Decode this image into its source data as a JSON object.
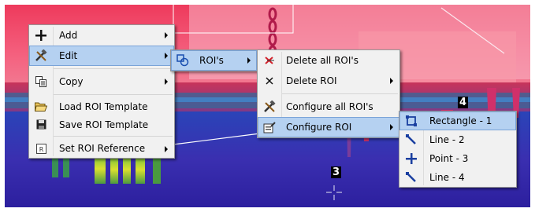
{
  "main_menu": {
    "items": [
      {
        "label": "Add",
        "icon": "plus-icon",
        "submenu": true
      },
      {
        "label": "Edit",
        "icon": "tools-icon",
        "submenu": true,
        "highlighted": true
      },
      {
        "label": "Copy",
        "icon": "copy-icon",
        "submenu": true
      },
      {
        "label": "Load ROI Template",
        "icon": "folder-open-icon"
      },
      {
        "label": "Save ROI Template",
        "icon": "floppy-disk-icon"
      },
      {
        "label": "Set ROI Reference",
        "icon": "reference-icon",
        "submenu": true
      }
    ]
  },
  "edit_menu": {
    "items": [
      {
        "label": "ROI's",
        "icon": "roi-shapes-icon",
        "submenu": true,
        "highlighted": true
      }
    ]
  },
  "rois_menu": {
    "items": [
      {
        "label": "Delete all ROI's",
        "icon": "delete-all-icon"
      },
      {
        "label": "Delete ROI",
        "icon": "delete-icon",
        "submenu": true
      },
      {
        "label": "Configure all ROI's",
        "icon": "tools-icon"
      },
      {
        "label": "Configure ROI",
        "icon": "configure-icon",
        "submenu": true,
        "highlighted": true
      }
    ]
  },
  "configure_menu": {
    "items": [
      {
        "label": "Rectangle - 1",
        "icon": "rectangle-icon",
        "highlighted": true
      },
      {
        "label": "Line - 2",
        "icon": "line-icon"
      },
      {
        "label": "Point - 3",
        "icon": "point-icon"
      },
      {
        "label": "Line - 4",
        "icon": "line-icon"
      }
    ]
  },
  "roi_labels": {
    "label_4": "4",
    "label_3": "3"
  },
  "colors": {
    "highlight": "#b5d1f1",
    "menu_bg": "#f1f1f1"
  }
}
